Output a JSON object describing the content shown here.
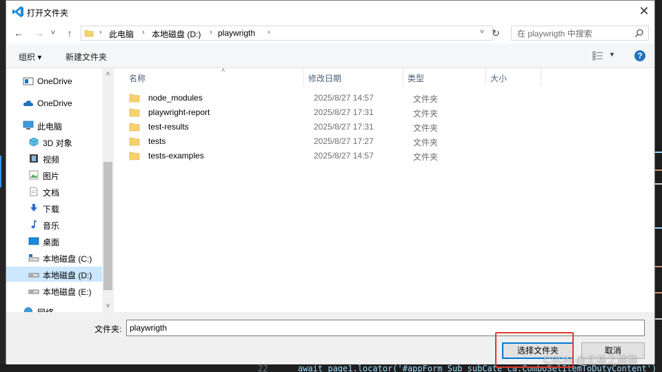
{
  "window": {
    "title": "打开文件夹",
    "close_symbol": "✕"
  },
  "nav": {
    "back_symbol": "←",
    "forward_symbol": "→",
    "recent_symbol": "˅",
    "up_symbol": "↑",
    "breadcrumbs": [
      "此电脑",
      "本地磁盘 (D:)",
      "playwrigth"
    ],
    "breadcrumb_sep": "›",
    "dropdown_symbol": "˅",
    "refresh_symbol": "↻",
    "search_placeholder": "在 playwrigth 中搜索"
  },
  "toolbar": {
    "organize_label": "组织 ▾",
    "new_folder_label": "新建文件夹",
    "view_dropdown_symbol": "▼",
    "help_symbol": "?"
  },
  "sidebar": {
    "items": [
      {
        "label": "OneDrive",
        "icon": "onedrive-icon",
        "selected": false
      },
      {
        "label": "OneDrive",
        "icon": "cloud-icon",
        "selected": false
      },
      {
        "label": "此电脑",
        "icon": "computer-icon",
        "selected": false
      },
      {
        "label": "3D 对象",
        "icon": "cube-3d-icon",
        "selected": false
      },
      {
        "label": "视频",
        "icon": "video-icon",
        "selected": false
      },
      {
        "label": "图片",
        "icon": "picture-icon",
        "selected": false
      },
      {
        "label": "文档",
        "icon": "document-icon",
        "selected": false
      },
      {
        "label": "下载",
        "icon": "download-icon",
        "selected": false
      },
      {
        "label": "音乐",
        "icon": "music-icon",
        "selected": false
      },
      {
        "label": "桌面",
        "icon": "desktop-icon",
        "selected": false
      },
      {
        "label": "本地磁盘 (C:)",
        "icon": "drive-c-icon",
        "selected": false
      },
      {
        "label": "本地磁盘 (D:)",
        "icon": "drive-d-icon",
        "selected": true
      },
      {
        "label": "本地磁盘 (E:)",
        "icon": "drive-e-icon",
        "selected": false
      },
      {
        "label": "网络",
        "icon": "network-icon",
        "selected": false
      }
    ],
    "scroll_up_symbol": "˄",
    "scroll_down_symbol": "˅"
  },
  "files": {
    "columns": [
      "名称",
      "修改日期",
      "类型",
      "大小"
    ],
    "sort_symbol": "˄",
    "rows": [
      {
        "name": "node_modules",
        "date": "2025/8/27 14:57",
        "type": "文件夹"
      },
      {
        "name": "playwright-report",
        "date": "2025/8/27 17:31",
        "type": "文件夹"
      },
      {
        "name": "test-results",
        "date": "2025/8/27 17:31",
        "type": "文件夹"
      },
      {
        "name": "tests",
        "date": "2025/8/27 17:27",
        "type": "文件夹"
      },
      {
        "name": "tests-examples",
        "date": "2025/8/27 14:57",
        "type": "文件夹"
      }
    ]
  },
  "footer": {
    "folder_label": "文件夹:",
    "folder_value": "playwrigth",
    "select_button": "选择文件夹",
    "cancel_button": "取消"
  },
  "background": {
    "line_number": "22",
    "code_text": "await page1.locator('#appForm_Sub_subCate ca.ComboSelItemToDutyContent')",
    "watermark": "CSDN @北极之熊熊"
  },
  "colors": {
    "selection": "#cce8ff",
    "accent": "#0078d7",
    "highlight_box": "#e0382e",
    "folder": "#f7d26b"
  }
}
